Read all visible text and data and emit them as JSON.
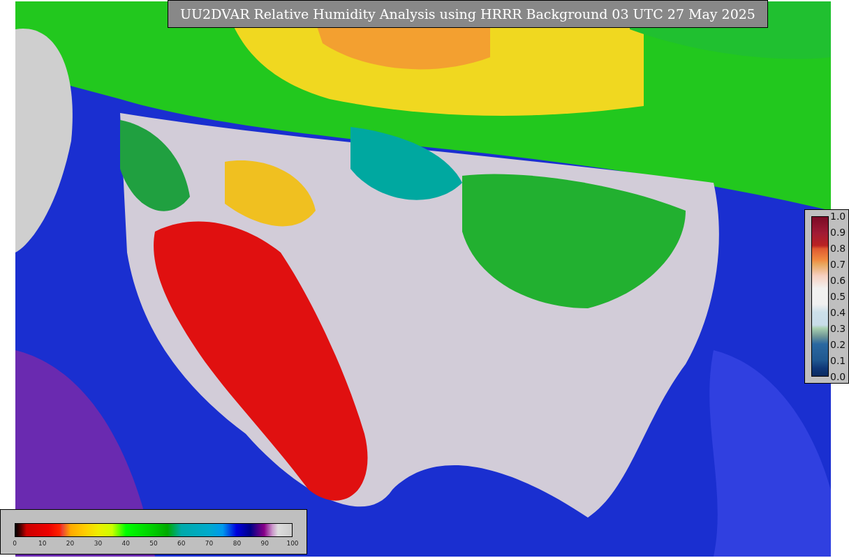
{
  "title": "UU2DVAR Relative Humidity Analysis using HRRR Background 03 UTC 27 May 2025",
  "humidity_colorbar": {
    "ticks": [
      "0",
      "10",
      "20",
      "30",
      "40",
      "50",
      "60",
      "70",
      "80",
      "90",
      "100"
    ]
  },
  "ratio_colorbar": {
    "ticks": [
      "1.0",
      "0.9",
      "0.8",
      "0.7",
      "0.6",
      "0.5",
      "0.4",
      "0.3",
      "0.2",
      "0.1",
      "0.0"
    ]
  }
}
